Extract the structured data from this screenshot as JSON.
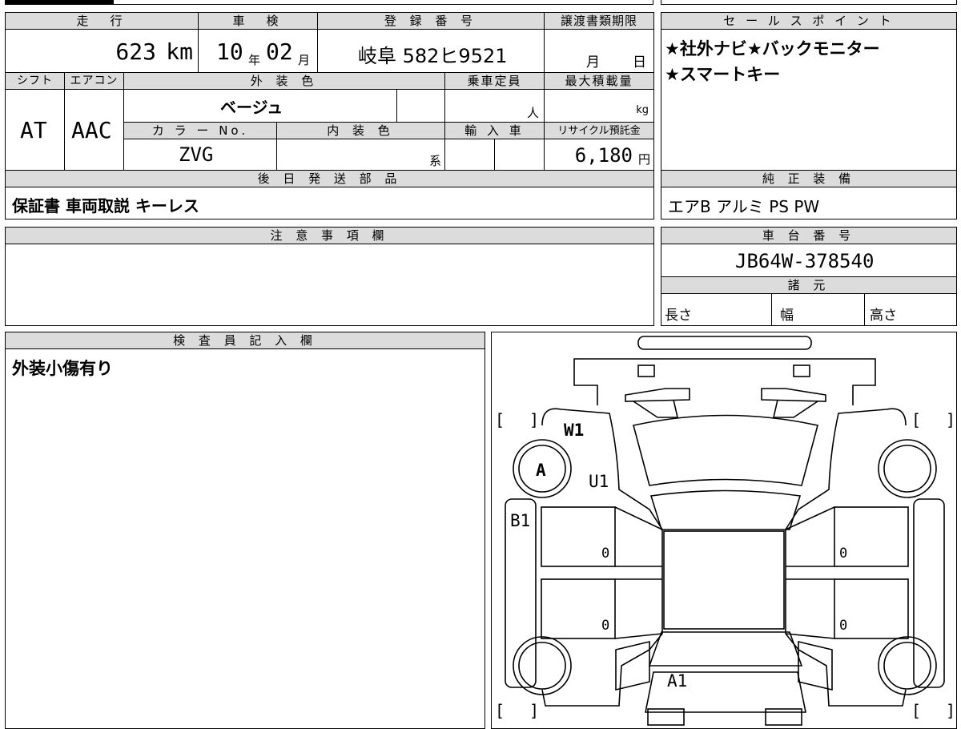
{
  "header": {
    "mileage_label": "走　行",
    "shaken_label": "車　検",
    "registration_label": "登 録 番 号",
    "transfer_deadline_label": "譲渡書類期限",
    "sales_point_label": "セ ー ル ス ポ イ ン ト"
  },
  "vehicle": {
    "mileage_value": "623",
    "mileage_unit": "km",
    "shaken_year": "10",
    "shaken_year_unit": "年",
    "shaken_month": "02",
    "shaken_month_unit": "月",
    "registration": "岐阜 582ヒ9521",
    "deadline_month_unit": "月",
    "deadline_day_unit": "日",
    "shift_label": "シフト",
    "aircon_label": "エアコン",
    "exterior_color_label": "外 装 色",
    "capacity_label": "乗車定員",
    "max_load_label": "最大積載量",
    "shift_value": "AT",
    "aircon_value": "AAC",
    "exterior_color_value": "ベージュ",
    "capacity_unit": "人",
    "max_load_unit": "kg",
    "color_no_label": "カ ラ ー No.",
    "interior_color_label": "内 装 色",
    "import_label": "輸 入 車",
    "recycle_label": "リサイクル預託金",
    "color_no_value": "ZVG",
    "interior_color_unit": "系",
    "recycle_value": "6,180",
    "recycle_unit": "円"
  },
  "sales_points": {
    "line1": "★社外ナビ★バックモニター",
    "line2": "★スマートキー"
  },
  "later_parts": {
    "label": "後 日 発 送 部 品",
    "value": "保証書 車両取説 キーレス"
  },
  "genuine_equipment": {
    "label": "純 正 装 備",
    "value": "エアB アルミ PS PW"
  },
  "notes": {
    "label": "注 意 事 項 欄",
    "value": ""
  },
  "chassis": {
    "label": "車 台 番 号",
    "value": "JB64W-378540"
  },
  "specs": {
    "label": "諸 元",
    "length_label": "長さ",
    "width_label": "幅",
    "height_label": "高さ"
  },
  "inspector": {
    "label": "検 査 員 記 入 欄",
    "value": "外装小傷有り"
  },
  "diagram_marks": {
    "w1": "W1",
    "a": "A",
    "u1": "U1",
    "b1": "B1",
    "zero_a": "0",
    "zero_b": "0",
    "zero_c": "0",
    "zero_d": "0",
    "a1": "A1"
  }
}
